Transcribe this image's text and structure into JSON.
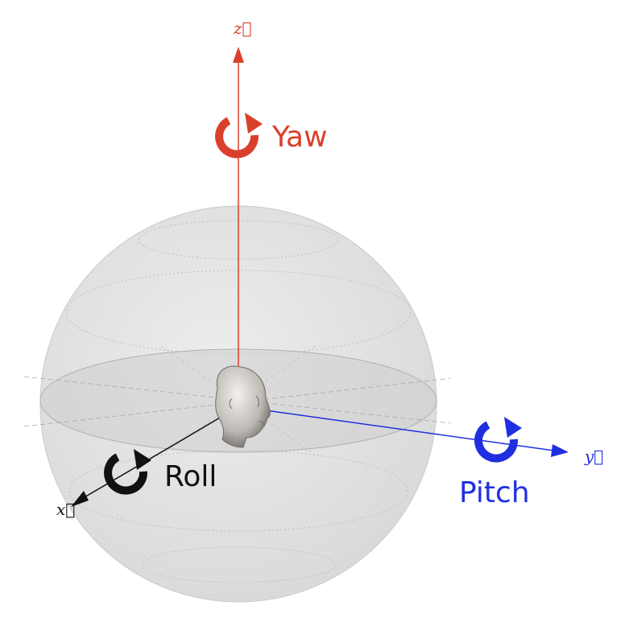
{
  "colors": {
    "yaw": "#d9402b",
    "pitch": "#1f2fe0",
    "roll": "#111111",
    "sphere_fill": "#e6e6e6",
    "sphere_line": "#b5b5b5",
    "equator_band": "#cfcfcf"
  },
  "axes": {
    "z": {
      "label": "z⃗"
    },
    "y": {
      "label": "y⃗"
    },
    "x": {
      "label": "x⃗"
    }
  },
  "rotations": {
    "yaw": {
      "label": "Yaw",
      "icon": "rotate-arrow-icon"
    },
    "pitch": {
      "label": "Pitch",
      "icon": "rotate-arrow-icon"
    },
    "roll": {
      "label": "Roll",
      "icon": "rotate-arrow-icon"
    }
  },
  "center": {
    "icon": "human-head-icon"
  }
}
